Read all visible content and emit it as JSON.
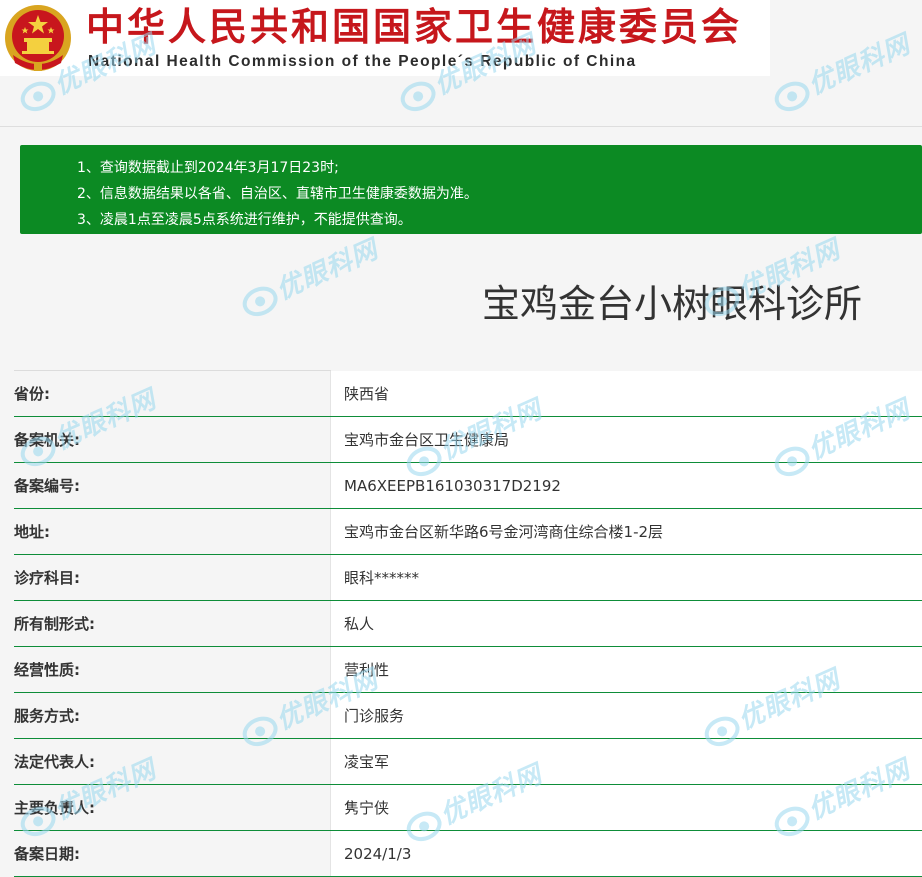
{
  "header": {
    "title_cn": "中华人民共和国国家卫生健康委员会",
    "title_en": "National Health Commission of the People´s Republic of China",
    "emblem_icon": "national-emblem-icon",
    "title_color": "#c6171c"
  },
  "notice": {
    "background": "#0c8a23",
    "items": [
      "1、查询数据截止到2024年3月17日23时;",
      "2、信息数据结果以各省、自治区、直辖市卫生健康委数据为准。",
      "3、凌晨1点至凌晨5点系统进行维护，不能提供查询。"
    ]
  },
  "organization": {
    "name": "宝鸡金台小树眼科诊所"
  },
  "details": [
    {
      "label": "省份:",
      "value": "陕西省"
    },
    {
      "label": "备案机关:",
      "value": "宝鸡市金台区卫生健康局"
    },
    {
      "label": "备案编号:",
      "value": "MA6XEEPB161030317D2192"
    },
    {
      "label": "地址:",
      "value": "宝鸡市金台区新华路6号金河湾商住综合楼1-2层"
    },
    {
      "label": "诊疗科目:",
      "value": "眼科******"
    },
    {
      "label": "所有制形式:",
      "value": "私人"
    },
    {
      "label": "经营性质:",
      "value": "营利性"
    },
    {
      "label": "服务方式:",
      "value": "门诊服务"
    },
    {
      "label": "法定代表人:",
      "value": "凌宝军"
    },
    {
      "label": "主要负责人:",
      "value": "隽宁侠"
    },
    {
      "label": "备案日期:",
      "value": "2024/1/3"
    }
  ],
  "watermark": {
    "text": "优眼科网",
    "icon": "eye-logo-icon",
    "color": "#9ad8ef"
  },
  "colors": {
    "row_divider": "#0e8d39",
    "page_background": "#f5f5f5"
  }
}
